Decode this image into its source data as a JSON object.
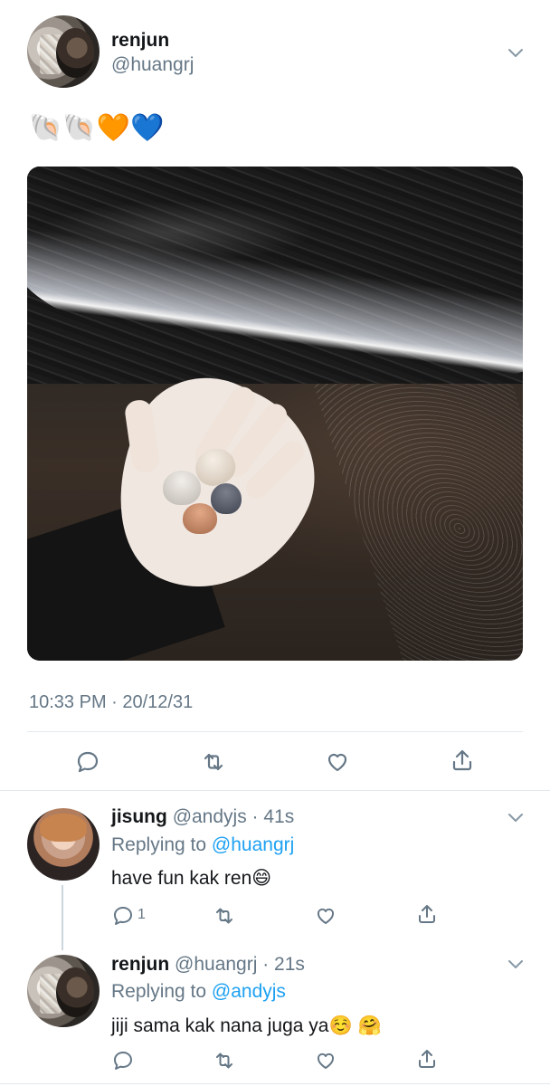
{
  "main_tweet": {
    "display_name": "renjun",
    "handle": "@huangrj",
    "text": "🐚🐚🧡💙",
    "image_alt": "hand holding seashells on a dark beach",
    "timestamp": "10:33 PM · 20/12/31"
  },
  "replies": [
    {
      "display_name": "jisung",
      "handle_time": "@andyjs · 41s",
      "replying_prefix": "Replying to",
      "replying_to": "@huangrj",
      "text": "have fun kak ren😄",
      "reply_count": "1"
    },
    {
      "display_name": "renjun",
      "handle_time": "@huangrj · 21s",
      "replying_prefix": "Replying to",
      "replying_to": "@andyjs",
      "text": "jiji sama kak nana juga ya☺️ 🤗"
    }
  ],
  "icons": {
    "chevron": "chevron-down-icon",
    "reply": "reply-icon",
    "retweet": "retweet-icon",
    "like": "heart-icon",
    "share": "share-icon"
  },
  "colors": {
    "link": "#1da1f2",
    "muted": "#657786",
    "text": "#14171a"
  }
}
